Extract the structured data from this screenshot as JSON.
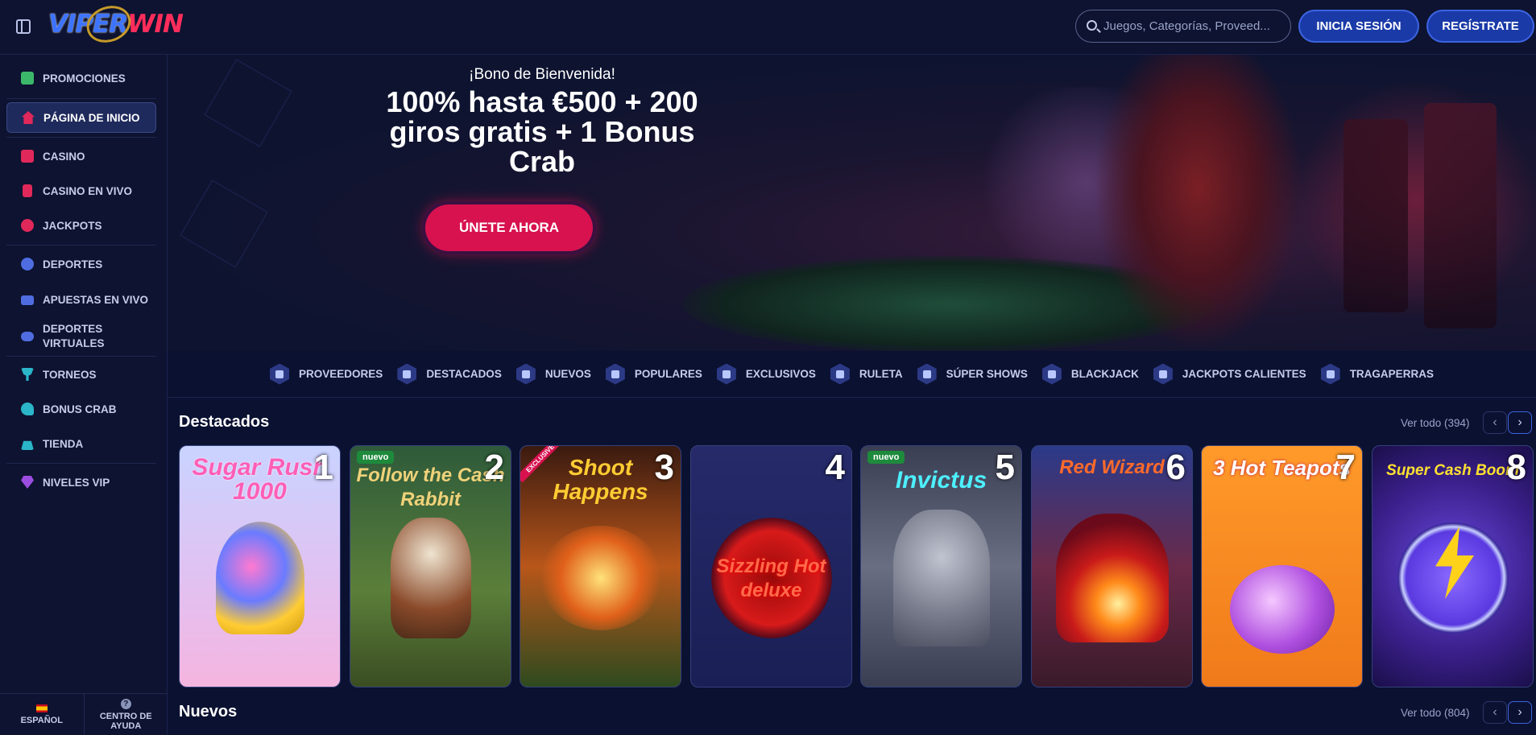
{
  "header": {
    "logo_left": "VIPER",
    "logo_right": "WIN",
    "search_placeholder": "Juegos, Categorías, Proveed...",
    "login_label": "INICIA SESIÓN",
    "register_label": "REGÍSTRATE"
  },
  "sidebar": {
    "items": [
      {
        "label": "PROMOCIONES",
        "icon": "gift-icon",
        "color": "#3cb86a"
      },
      {
        "label": "PÁGINA DE INICIO",
        "icon": "home-icon",
        "color": "#e0285a",
        "active": true
      },
      {
        "label": "CASINO",
        "icon": "slot-machine-icon",
        "color": "#e0285a"
      },
      {
        "label": "CASINO EN VIVO",
        "icon": "live-casino-icon",
        "color": "#e0285a"
      },
      {
        "label": "JACKPOTS",
        "icon": "clover-icon",
        "color": "#e0285a"
      },
      {
        "label": "DEPORTES",
        "icon": "ball-icon",
        "color": "#4f6de0"
      },
      {
        "label": "APUESTAS EN VIVO",
        "icon": "live-bets-icon",
        "color": "#4f6de0"
      },
      {
        "label": "DEPORTES VIRTUALES",
        "icon": "gamepad-icon",
        "color": "#4f6de0"
      },
      {
        "label": "TORNEOS",
        "icon": "trophy-icon",
        "color": "#2bb5c9"
      },
      {
        "label": "BONUS CRAB",
        "icon": "crab-icon",
        "color": "#2bb5c9"
      },
      {
        "label": "TIENDA",
        "icon": "shop-icon",
        "color": "#2bb5c9"
      },
      {
        "label": "NIVELES VIP",
        "icon": "diamond-icon",
        "color": "#9b4de0"
      }
    ],
    "footer": {
      "language": "ESPAÑOL",
      "help": "CENTRO DE AYUDA",
      "help_glyph": "?"
    }
  },
  "hero": {
    "subtitle": "¡Bono de Bienvenida!",
    "title": "100% hasta €500 + 200 giros gratis + 1 Bonus Crab",
    "cta": "ÚNETE AHORA"
  },
  "categories": [
    {
      "label": "PROVEEDORES",
      "icon": "providers-icon"
    },
    {
      "label": "DESTACADOS",
      "icon": "star-icon"
    },
    {
      "label": "NUEVOS",
      "icon": "new-icon"
    },
    {
      "label": "POPULARES",
      "icon": "flame-icon"
    },
    {
      "label": "EXCLUSIVOS",
      "icon": "gem-icon"
    },
    {
      "label": "RULETA",
      "icon": "roulette-icon"
    },
    {
      "label": "SÚPER SHOWS",
      "icon": "show-icon"
    },
    {
      "label": "BLACKJACK",
      "icon": "cards-icon"
    },
    {
      "label": "JACKPOTS CALIENTES",
      "icon": "hot-jackpot-icon"
    },
    {
      "label": "TRAGAPERRAS",
      "icon": "slots-icon"
    }
  ],
  "featured": {
    "title": "Destacados",
    "view_all": "Ver todo (394)",
    "games": [
      {
        "rank": "1",
        "title": "Sugar Rush 1000",
        "bg": "#c9b8f0",
        "accent": "#ff5fb7",
        "badge": ""
      },
      {
        "rank": "2",
        "title": "Follow the Cash Rabbit",
        "bg": "#3d6b3a",
        "accent": "#f0d27a",
        "badge": "nuevo"
      },
      {
        "rank": "3",
        "title": "Shoot Happens",
        "bg": "#7a4a1a",
        "accent": "#ffcc33",
        "badge": "EXCLUSIVE"
      },
      {
        "rank": "4",
        "title": "Sizzling Hot deluxe",
        "bg": "#1a1f55",
        "accent": "#ff3b3b",
        "badge": ""
      },
      {
        "rank": "5",
        "title": "Invictus",
        "bg": "#5a5e72",
        "accent": "#4df0ff",
        "badge": "nuevo"
      },
      {
        "rank": "6",
        "title": "Red Wizard",
        "bg": "#4a2a6a",
        "accent": "#ff6a2a",
        "badge": ""
      },
      {
        "rank": "7",
        "title": "3 Hot Teapots",
        "bg": "#f08a1a",
        "accent": "#e0285a",
        "badge": ""
      },
      {
        "rank": "8",
        "title": "Super Cash Boom",
        "bg": "#3a1f8a",
        "accent": "#ffe030",
        "badge": ""
      }
    ]
  },
  "new_section": {
    "title": "Nuevos",
    "view_all": "Ver todo (804)"
  }
}
